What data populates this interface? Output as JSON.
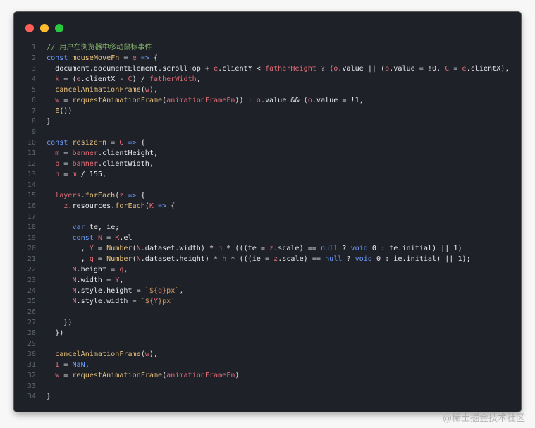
{
  "window": {
    "traffic_lights": [
      {
        "name": "close",
        "color": "#ff5f57"
      },
      {
        "name": "minimize",
        "color": "#febc2e"
      },
      {
        "name": "maximize",
        "color": "#28c840"
      }
    ]
  },
  "colors": {
    "keyword": "#6b9eff",
    "function": "#e6c07b",
    "variable": "#e06c75",
    "property": "#e7e9ee",
    "number": "#e7e9ee",
    "string": "#d19a66",
    "comment": "#84b36b",
    "plain": "#e7e9ee",
    "line_number": "#5c6370"
  },
  "code": [
    {
      "n": "1",
      "t": [
        [
          "comment",
          "// 用户在浏览器中移动鼠标事件"
        ]
      ]
    },
    {
      "n": "2",
      "t": [
        [
          "keyword",
          "const "
        ],
        [
          "function",
          "mouseMoveFn"
        ],
        [
          "plain",
          " = "
        ],
        [
          "variable",
          "e"
        ],
        [
          "plain",
          " "
        ],
        [
          "keyword",
          "=>"
        ],
        [
          "plain",
          " {"
        ]
      ]
    },
    {
      "n": "3",
      "t": [
        [
          "plain",
          "  document.documentElement.scrollTop + "
        ],
        [
          "variable",
          "e"
        ],
        [
          "plain",
          ".clientY < "
        ],
        [
          "variable",
          "fatherHeight"
        ],
        [
          "plain",
          " ? ("
        ],
        [
          "variable",
          "o"
        ],
        [
          "plain",
          ".value || ("
        ],
        [
          "variable",
          "o"
        ],
        [
          "plain",
          ".value = !0, "
        ],
        [
          "variable",
          "C"
        ],
        [
          "plain",
          " = "
        ],
        [
          "variable",
          "e"
        ],
        [
          "plain",
          ".clientX),"
        ]
      ]
    },
    {
      "n": "4",
      "t": [
        [
          "plain",
          "  "
        ],
        [
          "variable",
          "k"
        ],
        [
          "plain",
          " = ("
        ],
        [
          "variable",
          "e"
        ],
        [
          "plain",
          ".clientX - "
        ],
        [
          "variable",
          "C"
        ],
        [
          "plain",
          ") / "
        ],
        [
          "variable",
          "fatherWidth"
        ],
        [
          "plain",
          ","
        ]
      ]
    },
    {
      "n": "5",
      "t": [
        [
          "plain",
          "  "
        ],
        [
          "function",
          "cancelAnimationFrame"
        ],
        [
          "plain",
          "("
        ],
        [
          "variable",
          "w"
        ],
        [
          "plain",
          "),"
        ]
      ]
    },
    {
      "n": "6",
      "t": [
        [
          "plain",
          "  "
        ],
        [
          "variable",
          "w"
        ],
        [
          "plain",
          " = "
        ],
        [
          "function",
          "requestAnimationFrame"
        ],
        [
          "plain",
          "("
        ],
        [
          "variable",
          "animationFrameFn"
        ],
        [
          "plain",
          ")) : "
        ],
        [
          "variable",
          "o"
        ],
        [
          "plain",
          ".value && ("
        ],
        [
          "variable",
          "o"
        ],
        [
          "plain",
          ".value = !1,"
        ]
      ]
    },
    {
      "n": "7",
      "t": [
        [
          "plain",
          "  "
        ],
        [
          "function",
          "E"
        ],
        [
          "plain",
          "())"
        ]
      ]
    },
    {
      "n": "8",
      "t": [
        [
          "plain",
          "}"
        ]
      ]
    },
    {
      "n": "9",
      "t": []
    },
    {
      "n": "10",
      "t": [
        [
          "keyword",
          "const "
        ],
        [
          "function",
          "resizeFn"
        ],
        [
          "plain",
          " = "
        ],
        [
          "variable",
          "G"
        ],
        [
          "plain",
          " "
        ],
        [
          "keyword",
          "=>"
        ],
        [
          "plain",
          " {"
        ]
      ]
    },
    {
      "n": "11",
      "t": [
        [
          "plain",
          "  "
        ],
        [
          "variable",
          "m"
        ],
        [
          "plain",
          " = "
        ],
        [
          "variable",
          "banner"
        ],
        [
          "plain",
          ".clientHeight,"
        ]
      ]
    },
    {
      "n": "12",
      "t": [
        [
          "plain",
          "  "
        ],
        [
          "variable",
          "p"
        ],
        [
          "plain",
          " = "
        ],
        [
          "variable",
          "banner"
        ],
        [
          "plain",
          ".clientWidth,"
        ]
      ]
    },
    {
      "n": "13",
      "t": [
        [
          "plain",
          "  "
        ],
        [
          "variable",
          "h"
        ],
        [
          "plain",
          " = "
        ],
        [
          "variable",
          "m"
        ],
        [
          "plain",
          " / 155,"
        ]
      ]
    },
    {
      "n": "14",
      "t": []
    },
    {
      "n": "15",
      "t": [
        [
          "plain",
          "  "
        ],
        [
          "variable",
          "layers"
        ],
        [
          "plain",
          "."
        ],
        [
          "function",
          "forEach"
        ],
        [
          "plain",
          "("
        ],
        [
          "variable",
          "z"
        ],
        [
          "plain",
          " "
        ],
        [
          "keyword",
          "=>"
        ],
        [
          "plain",
          " {"
        ]
      ]
    },
    {
      "n": "16",
      "t": [
        [
          "plain",
          "    "
        ],
        [
          "variable",
          "z"
        ],
        [
          "plain",
          ".resources."
        ],
        [
          "function",
          "forEach"
        ],
        [
          "plain",
          "("
        ],
        [
          "variable",
          "K"
        ],
        [
          "plain",
          " "
        ],
        [
          "keyword",
          "=>"
        ],
        [
          "plain",
          " {"
        ]
      ]
    },
    {
      "n": "17",
      "t": []
    },
    {
      "n": "18",
      "t": [
        [
          "plain",
          "      "
        ],
        [
          "keyword",
          "var "
        ],
        [
          "plain",
          "te, ie;"
        ]
      ]
    },
    {
      "n": "19",
      "t": [
        [
          "plain",
          "      "
        ],
        [
          "keyword",
          "const "
        ],
        [
          "variable",
          "N"
        ],
        [
          "plain",
          " = "
        ],
        [
          "variable",
          "K"
        ],
        [
          "plain",
          ".el"
        ]
      ]
    },
    {
      "n": "20",
      "t": [
        [
          "plain",
          "        , "
        ],
        [
          "variable",
          "Y"
        ],
        [
          "plain",
          " = "
        ],
        [
          "function",
          "Number"
        ],
        [
          "plain",
          "("
        ],
        [
          "variable",
          "N"
        ],
        [
          "plain",
          ".dataset.width) * "
        ],
        [
          "variable",
          "h"
        ],
        [
          "plain",
          " * (((te = "
        ],
        [
          "variable",
          "z"
        ],
        [
          "plain",
          ".scale) == "
        ],
        [
          "keyword",
          "null"
        ],
        [
          "plain",
          " ? "
        ],
        [
          "keyword",
          "void"
        ],
        [
          "plain",
          " 0 : te.initial) || 1)"
        ]
      ]
    },
    {
      "n": "21",
      "t": [
        [
          "plain",
          "        , "
        ],
        [
          "variable",
          "q"
        ],
        [
          "plain",
          " = "
        ],
        [
          "function",
          "Number"
        ],
        [
          "plain",
          "("
        ],
        [
          "variable",
          "N"
        ],
        [
          "plain",
          ".dataset.height) * "
        ],
        [
          "variable",
          "h"
        ],
        [
          "plain",
          " * (((ie = "
        ],
        [
          "variable",
          "z"
        ],
        [
          "plain",
          ".scale) == "
        ],
        [
          "keyword",
          "null"
        ],
        [
          "plain",
          " ? "
        ],
        [
          "keyword",
          "void"
        ],
        [
          "plain",
          " 0 : ie.initial) || 1);"
        ]
      ]
    },
    {
      "n": "22",
      "t": [
        [
          "plain",
          "      "
        ],
        [
          "variable",
          "N"
        ],
        [
          "plain",
          ".height = "
        ],
        [
          "variable",
          "q"
        ],
        [
          "plain",
          ","
        ]
      ]
    },
    {
      "n": "23",
      "t": [
        [
          "plain",
          "      "
        ],
        [
          "variable",
          "N"
        ],
        [
          "plain",
          ".width = "
        ],
        [
          "variable",
          "Y"
        ],
        [
          "plain",
          ","
        ]
      ]
    },
    {
      "n": "24",
      "t": [
        [
          "plain",
          "      "
        ],
        [
          "variable",
          "N"
        ],
        [
          "plain",
          ".style.height = "
        ],
        [
          "string",
          "`${"
        ],
        [
          "variable",
          "q"
        ],
        [
          "string",
          "}px`"
        ],
        [
          "plain",
          ","
        ]
      ]
    },
    {
      "n": "25",
      "t": [
        [
          "plain",
          "      "
        ],
        [
          "variable",
          "N"
        ],
        [
          "plain",
          ".style.width = "
        ],
        [
          "string",
          "`${"
        ],
        [
          "variable",
          "Y"
        ],
        [
          "string",
          "}px`"
        ]
      ]
    },
    {
      "n": "26",
      "t": []
    },
    {
      "n": "27",
      "t": [
        [
          "plain",
          "    })"
        ]
      ]
    },
    {
      "n": "28",
      "t": [
        [
          "plain",
          "  })"
        ]
      ]
    },
    {
      "n": "29",
      "t": []
    },
    {
      "n": "30",
      "t": [
        [
          "plain",
          "  "
        ],
        [
          "function",
          "cancelAnimationFrame"
        ],
        [
          "plain",
          "("
        ],
        [
          "variable",
          "w"
        ],
        [
          "plain",
          "),"
        ]
      ]
    },
    {
      "n": "31",
      "t": [
        [
          "plain",
          "  "
        ],
        [
          "variable",
          "I"
        ],
        [
          "plain",
          " = "
        ],
        [
          "keyword",
          "NaN"
        ],
        [
          "plain",
          ","
        ]
      ]
    },
    {
      "n": "32",
      "t": [
        [
          "plain",
          "  "
        ],
        [
          "variable",
          "w"
        ],
        [
          "plain",
          " = "
        ],
        [
          "function",
          "requestAnimationFrame"
        ],
        [
          "plain",
          "("
        ],
        [
          "variable",
          "animationFrameFn"
        ],
        [
          "plain",
          ")"
        ]
      ]
    },
    {
      "n": "33",
      "t": []
    },
    {
      "n": "34",
      "t": [
        [
          "plain",
          "}"
        ]
      ]
    }
  ],
  "watermark": "@稀土掘金技术社区"
}
